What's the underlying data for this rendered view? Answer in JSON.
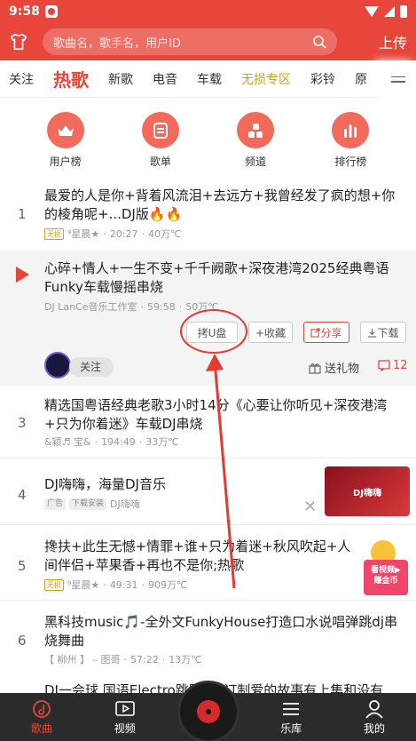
{
  "status_bar": {
    "time": "9:58"
  },
  "header": {
    "search_placeholder": "歌曲名，歌手名，用户ID",
    "upload_label": "上传"
  },
  "tabs": [
    "关注",
    "热歌",
    "新歌",
    "电音",
    "车载",
    "无损专区",
    "彩铃",
    "原"
  ],
  "categories": [
    "用户榜",
    "歌单",
    "频道",
    "排行榜"
  ],
  "songs": [
    {
      "num": "1",
      "title": "最爱的人是你+背着风流泪+去远方+我曾经发了疯的想+你的棱角呢+...DJ版🔥🔥",
      "tag": "无损",
      "artist": "⁹星晨★",
      "duration": "20:27",
      "plays": "40万℃"
    },
    {
      "title": "心碎+情人+一生不变+千千阙歌+深夜港湾2025经典粤语Funky车载慢摇串烧",
      "artist": "DJ LanCe音乐工作室",
      "duration": "59:58",
      "plays": "50万℃"
    },
    {
      "num": "3",
      "title": "精选国粤语经典老歌3小时14分《心要让你听见+深夜港湾+只为你着迷》车载DJ串烧",
      "artist": "&颖♬ 宝&",
      "duration": "194:49",
      "plays": "33万℃"
    },
    {
      "num": "4",
      "title": "DJ嗨嗨，海量DJ音乐",
      "tag1": "广告",
      "tag2": "下载安装",
      "artist": "DJ嗨嗨",
      "ad_image_text": "DJ嗨嗨"
    },
    {
      "num": "5",
      "title": "搀扶+此生无憾+情罪+谁+只为着迷+秋风吹起+人间伴侣+苹果香+再也不是你;热歌",
      "tag": "无损",
      "artist": "⁹星晨★",
      "duration": "49:31",
      "plays": "909万℃"
    },
    {
      "num": "6",
      "title": "黑科技music🎵-全外文FunkyHouse打造口水说唱弹跳dj串烧舞曲",
      "artist": "【 柳州 】 – 图哥",
      "duration": "57:22",
      "plays": "13万℃"
    },
    {
      "title": "DJ一会球 国语Electro跳跳 最 订制爱的故事有上集和没有"
    }
  ],
  "expanded": {
    "buttons": {
      "usb": "拷U盘",
      "collect": "+收藏",
      "share": "分享",
      "download": "下载"
    },
    "follow_label": "关注",
    "gift_label": "送礼物",
    "comment_count": "12"
  },
  "promo": {
    "line1": "看视频▶",
    "line2": "赚金币"
  },
  "bottom_nav": [
    "歌曲",
    "视频",
    "乐库",
    "我的"
  ],
  "colors": {
    "accent": "#e8463a",
    "gold": "#d9a013"
  }
}
